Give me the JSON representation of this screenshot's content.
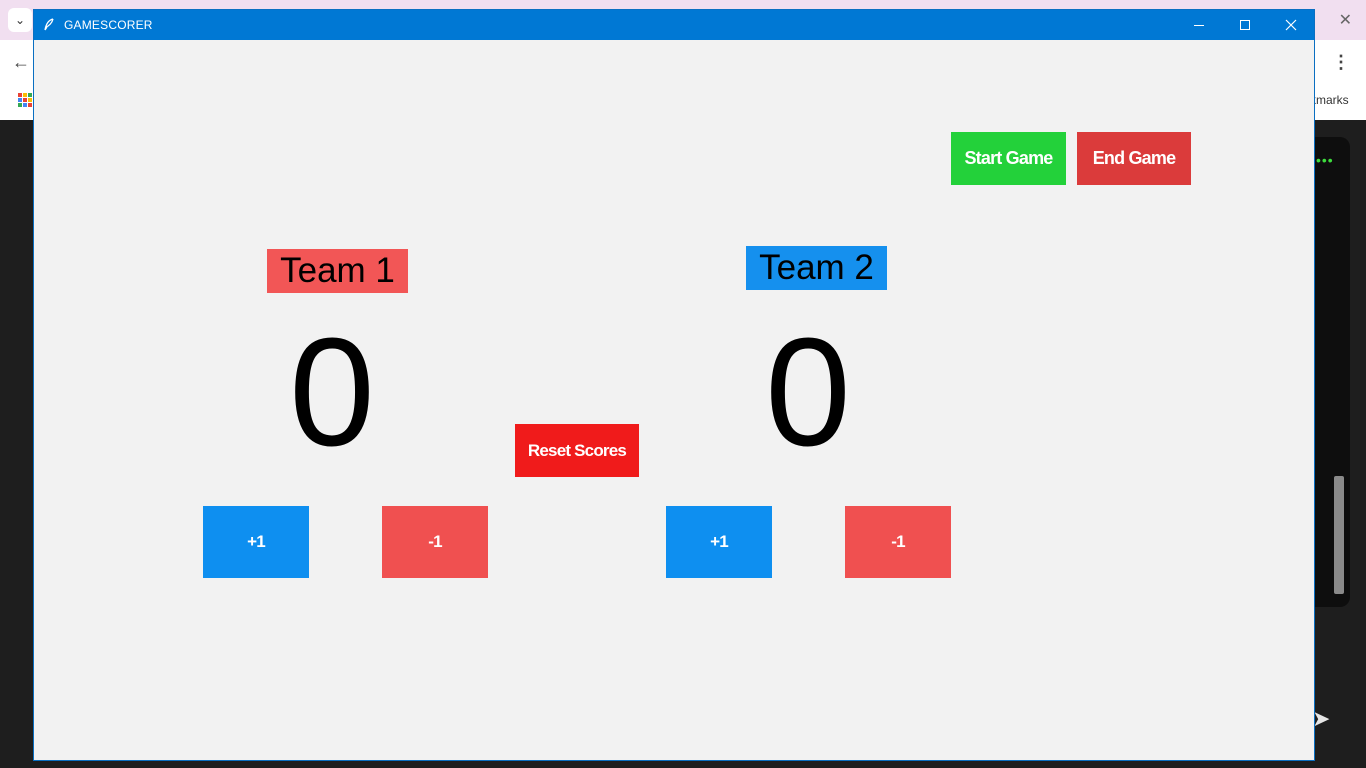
{
  "window": {
    "title": "GAMESCORER",
    "controls": {
      "minimize": "minimize",
      "maximize": "maximize",
      "close": "close"
    }
  },
  "game_controls": {
    "start_label": "Start Game",
    "end_label": "End Game",
    "reset_label": "Reset Scores"
  },
  "teams": [
    {
      "name": "Team 1",
      "score": "0",
      "plus_label": "+1",
      "minus_label": "-1",
      "color": "#f25656"
    },
    {
      "name": "Team 2",
      "score": "0",
      "plus_label": "+1",
      "minus_label": "-1",
      "color": "#1590ee"
    }
  ],
  "colors": {
    "titlebar": "#0078d4",
    "start_button": "#23d13a",
    "end_button": "#db3b3b",
    "reset_button": "#f01b1b",
    "plus_button": "#0e8ff0",
    "minus_button": "#f05050",
    "client_background": "#f2f2f2"
  },
  "background_browser": {
    "bookmarks_text": "kmarks"
  }
}
